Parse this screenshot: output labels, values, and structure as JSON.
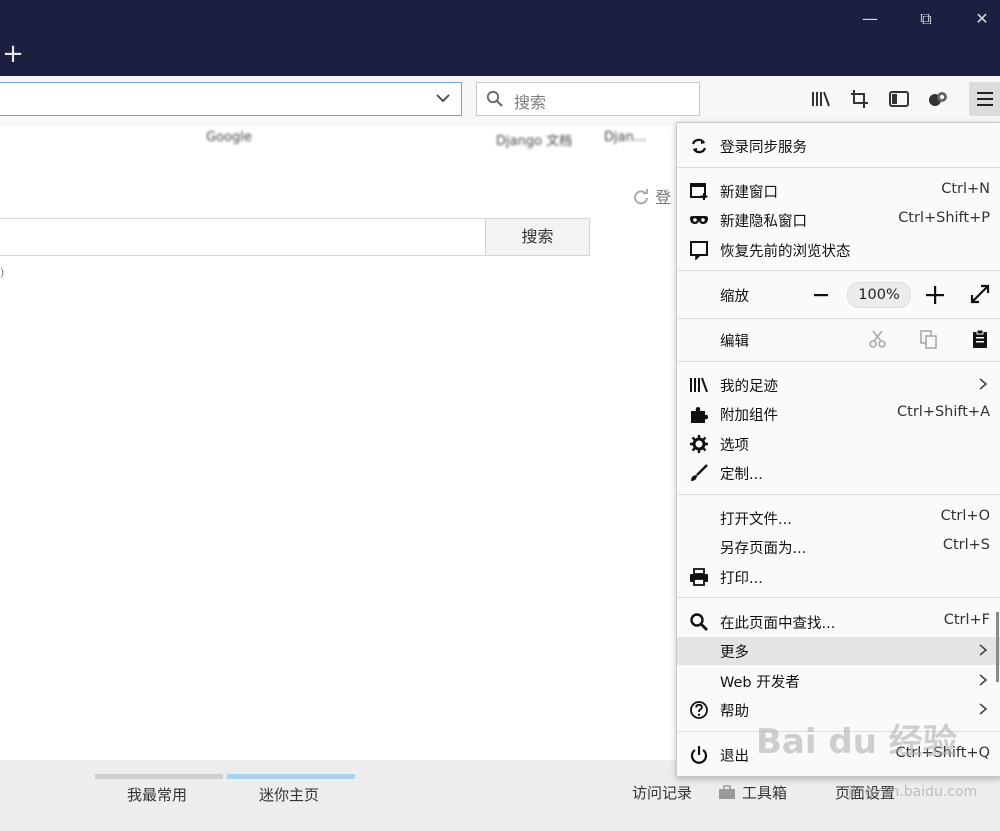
{
  "window": {
    "minimize_glyph": "—",
    "restore_glyph": "⧉",
    "close_glyph": "✕",
    "new_tab_glyph": "+"
  },
  "toolbar": {
    "search_placeholder": "搜索"
  },
  "bookmarks": [
    "Google",
    "Django 文档",
    "Djan..."
  ],
  "page": {
    "login_text": "登",
    "search_button": "搜索",
    "small_mark": ")"
  },
  "menu": {
    "sync": "登录同步服务",
    "new_window": {
      "label": "新建窗口",
      "shortcut": "Ctrl+N"
    },
    "private_window": {
      "label": "新建隐私窗口",
      "shortcut": "Ctrl+Shift+P"
    },
    "restore_session": {
      "label": "恢复先前的浏览状态"
    },
    "zoom": {
      "label": "缩放",
      "minus": "−",
      "value": "100%",
      "plus": "+"
    },
    "edit": {
      "label": "编辑"
    },
    "library": {
      "label": "我的足迹"
    },
    "addons": {
      "label": "附加组件",
      "shortcut": "Ctrl+Shift+A"
    },
    "options": {
      "label": "选项"
    },
    "customize": {
      "label": "定制..."
    },
    "open_file": {
      "label": "打开文件...",
      "shortcut": "Ctrl+O"
    },
    "save_page": {
      "label": "另存页面为...",
      "shortcut": "Ctrl+S"
    },
    "print": {
      "label": "打印..."
    },
    "find": {
      "label": "在此页面中查找...",
      "shortcut": "Ctrl+F"
    },
    "more": {
      "label": "更多"
    },
    "web_dev": {
      "label": "Web 开发者"
    },
    "help": {
      "label": "帮助"
    },
    "quit": {
      "label": "退出",
      "shortcut": "Ctrl+Shift+Q"
    }
  },
  "footer": {
    "tab_frequent": "我最常用",
    "tab_mini": "迷你主页",
    "history": "访问记录",
    "toolbox": "工具箱",
    "page_settings": "页面设置"
  },
  "watermark": {
    "text": "Bai du 经验",
    "sub": "jingyan.baidu.com"
  },
  "colors": {
    "titlebar": "#1c1f3f",
    "accent_tab": "#a7d3f0",
    "urlbar_focus": "#6ea4e0"
  }
}
